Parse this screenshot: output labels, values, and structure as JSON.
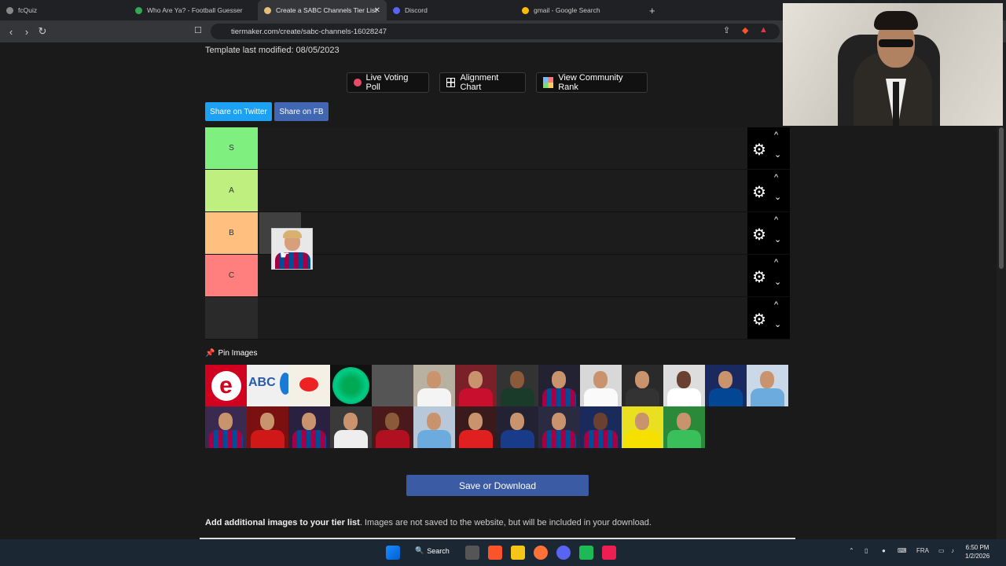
{
  "browser": {
    "tabs": [
      {
        "title": "fcQuiz",
        "color": "#888"
      },
      {
        "title": "Who Are Ya? - Football Guesser",
        "color": "#34a853"
      },
      {
        "title": "Create a SABC Channels Tier List",
        "color": "#e5c07b",
        "active": true
      },
      {
        "title": "Discord",
        "color": "#5865f2"
      },
      {
        "title": "gmail - Google Search",
        "color": "#fbbc05"
      }
    ],
    "url": "tiermaker.com/create/sabc-channels-16028247"
  },
  "page": {
    "modified": "Template last modified: 08/05/2023",
    "buttons": {
      "live_poll": "Live Voting Poll",
      "alignment": "Alignment Chart",
      "community": "View Community Rank",
      "twitter": "Share on Twitter",
      "facebook": "Share on FB"
    },
    "tiers": [
      {
        "label": "S",
        "color": "#7ff07f"
      },
      {
        "label": "A",
        "color": "#bff07f"
      },
      {
        "label": "B",
        "color": "#ffbf7f"
      },
      {
        "label": "C",
        "color": "#ff7f7f"
      },
      {
        "label": "",
        "color": "#2a2a2a"
      }
    ],
    "pin_label": "Pin Images",
    "save_label": "Save or Download",
    "add_bold": "Add additional images to your tier list",
    "add_rest": ". Images are not saved to the website, but will be included in your download."
  },
  "taskbar": {
    "search": "Search",
    "lang": "FRA",
    "time": "6:50 PM",
    "date": "1/2/2026"
  }
}
